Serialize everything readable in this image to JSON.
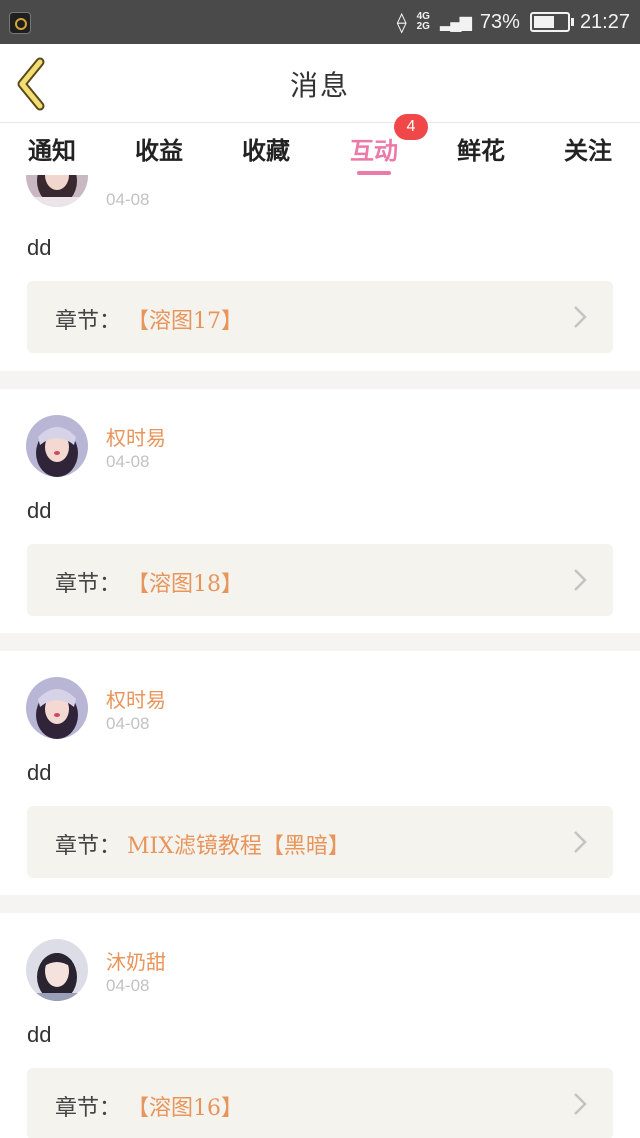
{
  "status_bar": {
    "network": "4G\n2G",
    "battery": "73%",
    "battery_level": 0.73,
    "time": "21:27"
  },
  "header": {
    "title": "消息",
    "back_icon": "chevron-left-icon"
  },
  "tabs": [
    {
      "label": "通知"
    },
    {
      "label": "收益"
    },
    {
      "label": "收藏"
    },
    {
      "label": "互动",
      "active": true,
      "badge": "4"
    },
    {
      "label": "鲜花"
    },
    {
      "label": "关注"
    }
  ],
  "colors": {
    "accent": "#ec7aa8",
    "name": "#e8955b",
    "badge": "#f04848"
  },
  "messages": [
    {
      "user": "",
      "date": "04-08",
      "text": "dd",
      "chapter_label": "章节：",
      "chapter": "【溶图17】"
    },
    {
      "user": "权时易",
      "date": "04-08",
      "text": "dd",
      "chapter_label": "章节：",
      "chapter": "【溶图18】"
    },
    {
      "user": "权时易",
      "date": "04-08",
      "text": "dd",
      "chapter_label": "章节：",
      "chapter": "MIX滤镜教程【黑暗】"
    },
    {
      "user": "沐奶甜",
      "date": "04-08",
      "text": "dd",
      "chapter_label": "章节：",
      "chapter": "【溶图16】"
    }
  ]
}
